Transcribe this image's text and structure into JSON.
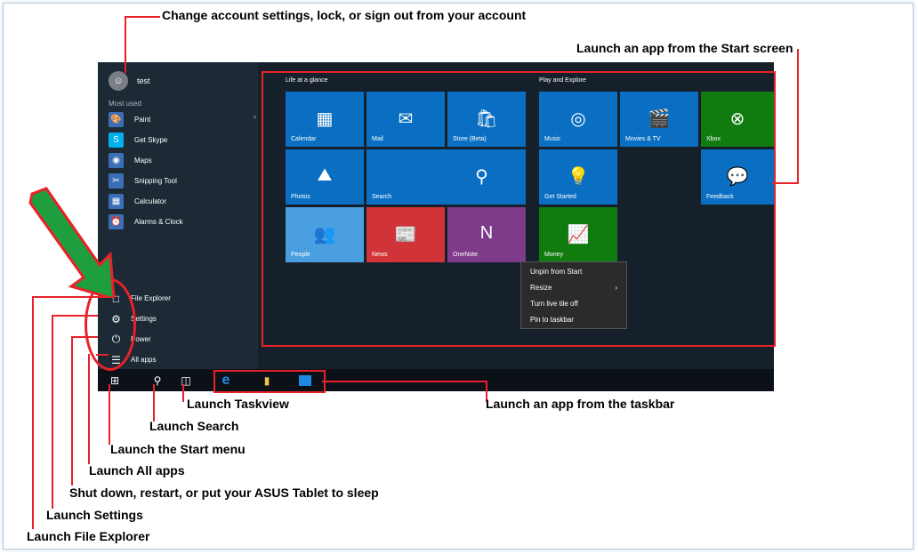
{
  "screen": {
    "user": {
      "name": "test"
    },
    "most_used_label": "Most used",
    "apps": [
      {
        "label": "Paint",
        "icon": "paint-icon",
        "color": "#3a6fb7"
      },
      {
        "label": "Get Skype",
        "icon": "skype-icon",
        "color": "#00aff0"
      },
      {
        "label": "Maps",
        "icon": "maps-icon",
        "color": "#3a6fb7"
      },
      {
        "label": "Snipping Tool",
        "icon": "scissors-icon",
        "color": "#3a6fb7"
      },
      {
        "label": "Calculator",
        "icon": "calculator-icon",
        "color": "#3a6fb7"
      },
      {
        "label": "Alarms & Clock",
        "icon": "alarm-clock-icon",
        "color": "#3a6fb7"
      }
    ],
    "bottom_items": [
      {
        "label": "File Explorer",
        "icon": "folder-icon"
      },
      {
        "label": "Settings",
        "icon": "gear-icon"
      },
      {
        "label": "Power",
        "icon": "power-icon"
      },
      {
        "label": "All apps",
        "icon": "list-icon"
      }
    ],
    "groups": {
      "life": "Life at a glance",
      "play": "Play and Explore"
    },
    "tiles": {
      "calendar": "Calendar",
      "mail": "Mail",
      "store": "Store (Beta)",
      "music": "Music",
      "movies": "Movies & TV",
      "xbox": "Xbox",
      "photos": "Photos",
      "search": "Search",
      "get_started": "Get Started",
      "feedback": "Feedback",
      "people": "People",
      "news": "News",
      "onenote": "OneNote",
      "money": "Money"
    },
    "context_menu": [
      "Unpin from Start",
      "Resize",
      "Turn live tile off",
      "Pin to taskbar"
    ]
  },
  "annotations": {
    "account": "Change account settings, lock, or sign out from your account",
    "start_screen": "Launch an app from the Start screen",
    "taskview": "Launch Taskview",
    "search": "Launch Search",
    "start_menu": "Launch the Start menu",
    "all_apps": "Launch All apps",
    "power": "Shut down, restart, or put your ASUS Tablet to sleep",
    "settings": "Launch Settings",
    "file_explorer": "Launch File Explorer",
    "taskbar": "Launch an app from the taskbar"
  },
  "colors": {
    "annotation_red": "#e8212a",
    "arrow_green": "#1e9e3e",
    "tile_blue": "#0a6fc2",
    "tile_green": "#107c10",
    "tile_red": "#d13438",
    "tile_purple": "#7e3b8a"
  }
}
